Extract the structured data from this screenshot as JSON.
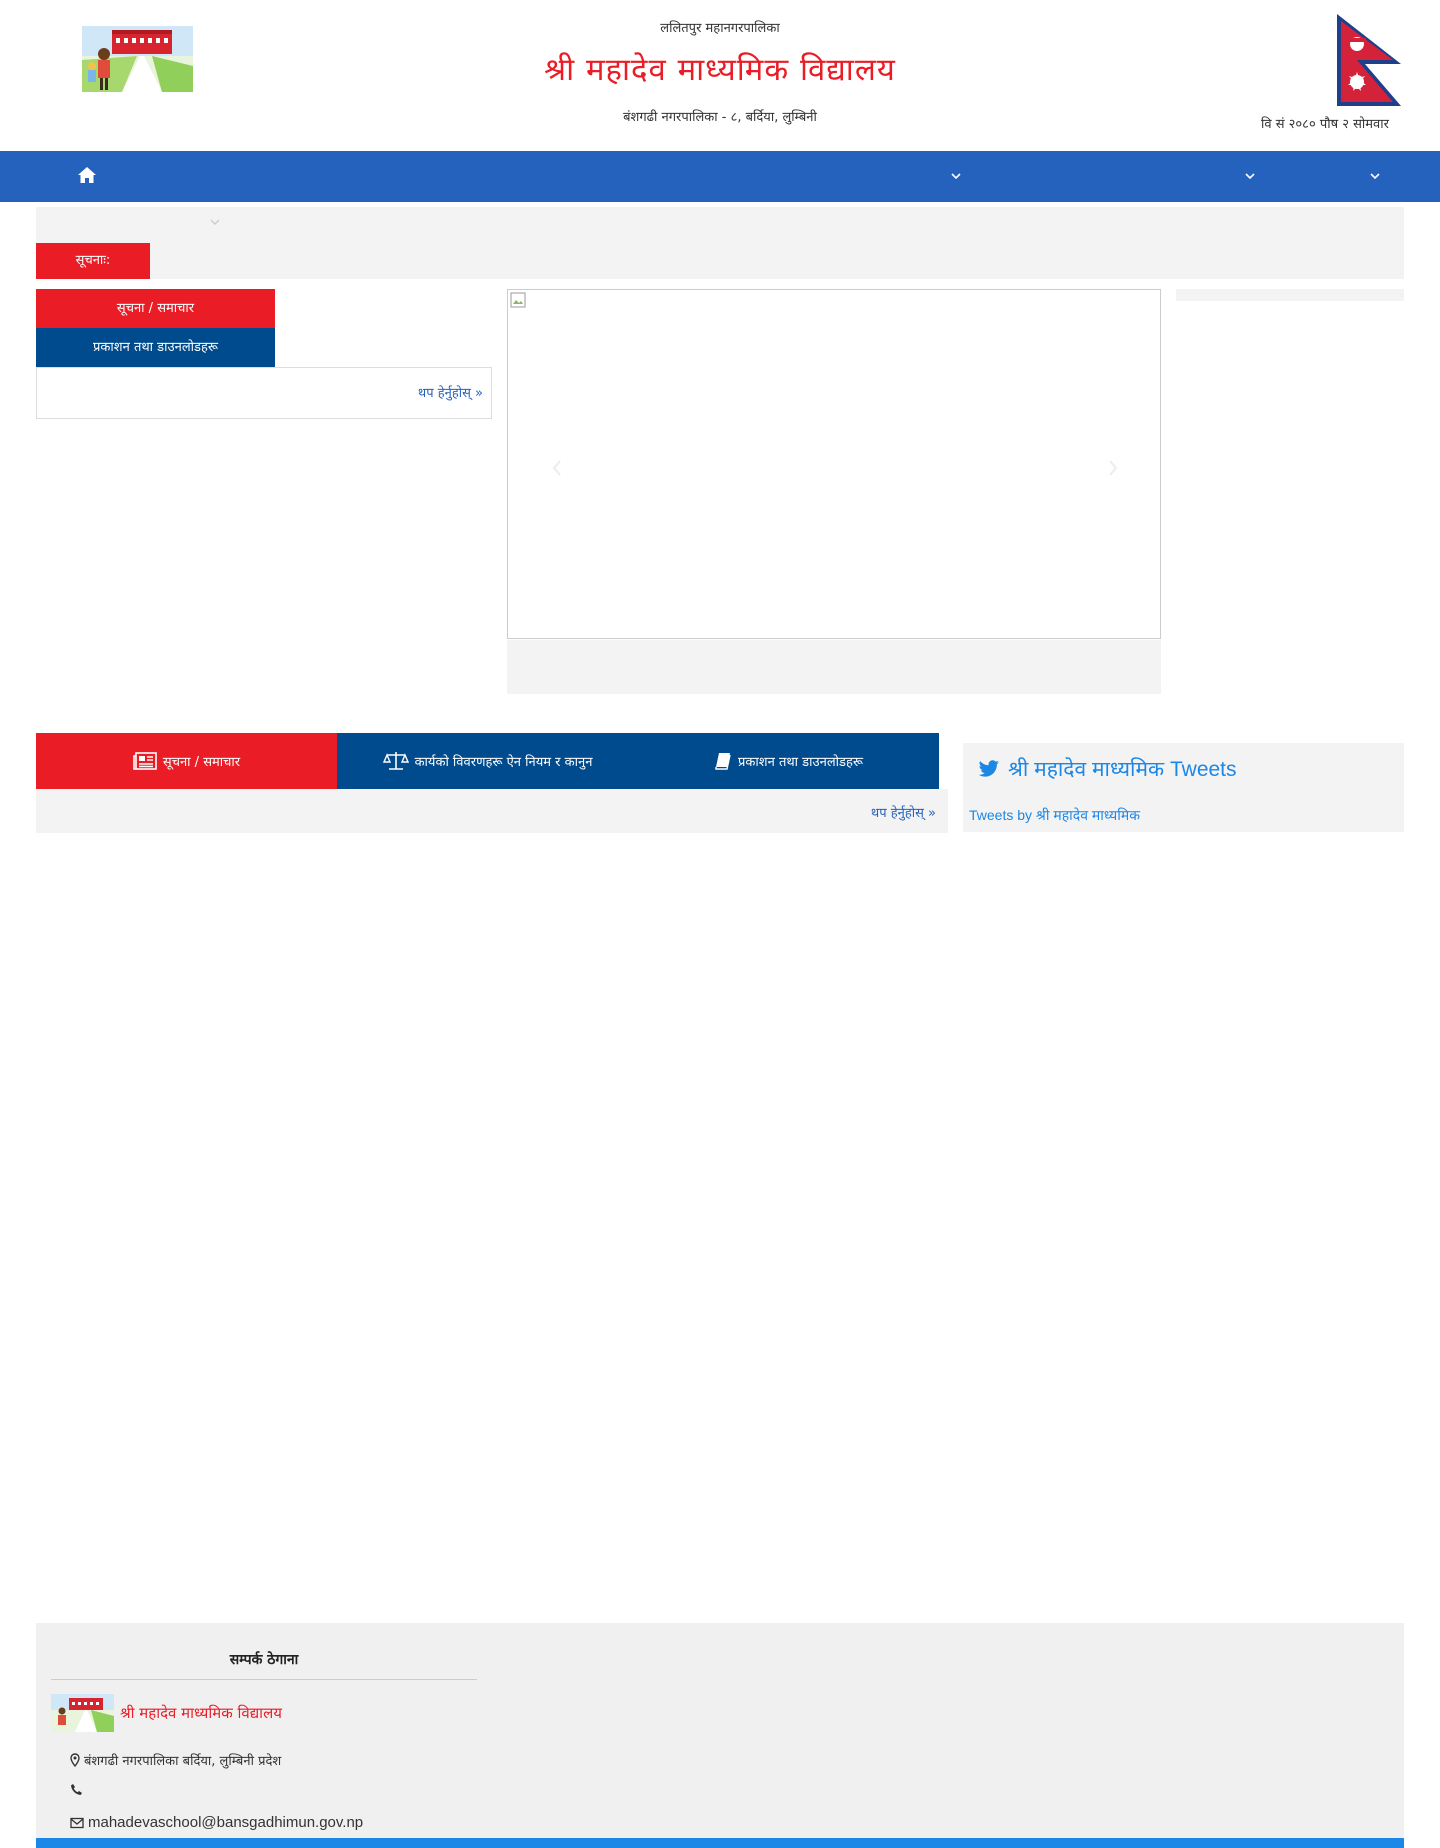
{
  "header": {
    "small_text": "ललितपुर महानगरपालिका",
    "title": "श्री महादेव माध्यमिक विद्यालय",
    "address": "बंशगढी नगरपालिका - ८, बर्दिया, लुम्बिनी",
    "date": "वि सं २०८० पौष २ सोमवार"
  },
  "nav": {
    "icons": [
      "home-icon",
      "chevron-down-icon",
      "chevron-down-icon",
      "chevron-down-icon"
    ]
  },
  "ticker": {
    "label": "सूचनाः:"
  },
  "left_tabs": {
    "tab1": "सूचना / समाचार",
    "tab2": "प्रकाशन तथा डाउनलोडहरू",
    "more": "थप हेर्नुहोस् »"
  },
  "tabs2": {
    "tab1": "सूचना / समाचार",
    "tab2": "कार्यको विवरणहरू ऐन नियम र कानुन",
    "tab3": "प्रकाशन तथा डाउनलोडहरू",
    "more": "थप हेर्नुहोस् »"
  },
  "tweets": {
    "title": "श्री महादेव माध्यमिक Tweets",
    "by": "Tweets by श्री महादेव माध्यमिक"
  },
  "footer": {
    "heading": "सम्पर्क ठेगाना",
    "name": "श्री महादेव माध्यमिक विद्यालय",
    "address": "बंशगढी नगरपालिका बर्दिया, लुम्बिनी प्रदेश",
    "phone": "",
    "email": "mahadevaschool@bansgadhimun.gov.np"
  },
  "colors": {
    "primary_blue": "#2462bd",
    "dark_blue": "#004b8d",
    "red": "#ea1c25",
    "twitter_blue": "#1b87e6"
  }
}
